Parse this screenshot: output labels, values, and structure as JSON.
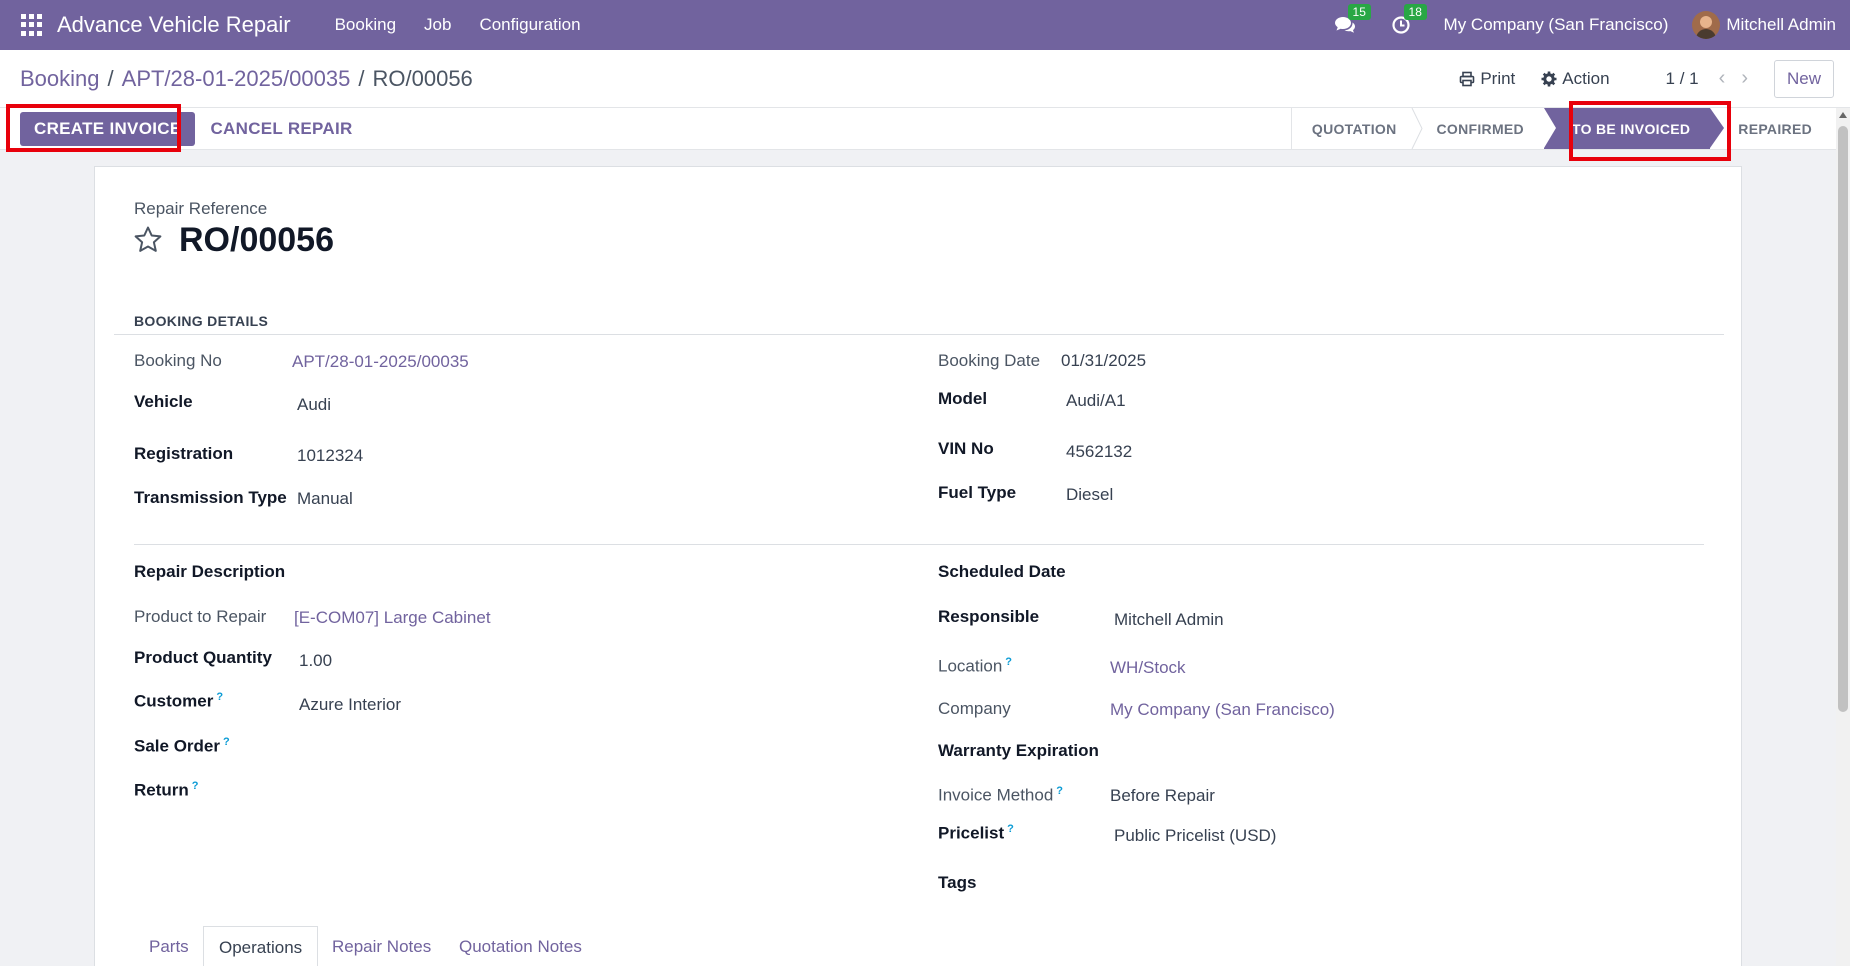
{
  "navbar": {
    "brand": "Advance Vehicle Repair",
    "menu": [
      "Booking",
      "Job",
      "Configuration"
    ],
    "messages_count": "15",
    "activities_count": "18",
    "company": "My Company (San Francisco)",
    "user": "Mitchell Admin"
  },
  "breadcrumb": {
    "item1": "Booking",
    "sep": "/",
    "item2": "APT/28-01-2025/00035",
    "current": "RO/00056"
  },
  "control": {
    "print_label": "Print",
    "action_label": "Action",
    "pager": "1 / 1",
    "new_label": "New"
  },
  "statusbar": {
    "create_invoice": "CREATE INVOICE",
    "cancel_repair": "CANCEL REPAIR",
    "stages": [
      "QUOTATION",
      "CONFIRMED",
      "TO BE INVOICED",
      "REPAIRED"
    ],
    "active_stage": "TO BE INVOICED",
    "accent_color": "#71639e",
    "highlight_color": "#e8000b"
  },
  "form": {
    "ref_label": "Repair Reference",
    "ref_value": "RO/00056",
    "booking_details_header": "BOOKING DETAILS",
    "left1": {
      "booking_no_label": "Booking No",
      "booking_no": "APT/28-01-2025/00035",
      "vehicle_label": "Vehicle",
      "vehicle": "Audi",
      "registration_label": "Registration",
      "registration": "1012324",
      "transmission_label": "Transmission Type",
      "transmission": "Manual"
    },
    "right1": {
      "booking_date_label": "Booking Date",
      "booking_date": "01/31/2025",
      "model_label": "Model",
      "model": "Audi/A1",
      "vin_label": "VIN No",
      "vin": "4562132",
      "fuel_label": "Fuel Type",
      "fuel": "Diesel"
    },
    "left2": {
      "repair_desc_label": "Repair Description",
      "product_label": "Product to Repair",
      "product": "[E-COM07] Large Cabinet",
      "qty_label": "Product Quantity",
      "qty": "1.00",
      "customer_label": "Customer",
      "customer": "Azure Interior",
      "sale_order_label": "Sale Order",
      "return_label": "Return"
    },
    "right2": {
      "scheduled_label": "Scheduled Date",
      "responsible_label": "Responsible",
      "responsible": "Mitchell Admin",
      "location_label": "Location",
      "location": "WH/Stock",
      "company_label": "Company",
      "company": "My Company (San Francisco)",
      "warranty_label": "Warranty Expiration",
      "invoice_method_label": "Invoice Method",
      "invoice_method": "Before Repair",
      "pricelist_label": "Pricelist",
      "pricelist": "Public Pricelist (USD)",
      "tags_label": "Tags"
    },
    "help_mark": "?",
    "tabs": [
      "Parts",
      "Operations",
      "Repair Notes",
      "Quotation Notes"
    ],
    "active_tab": "Operations"
  }
}
